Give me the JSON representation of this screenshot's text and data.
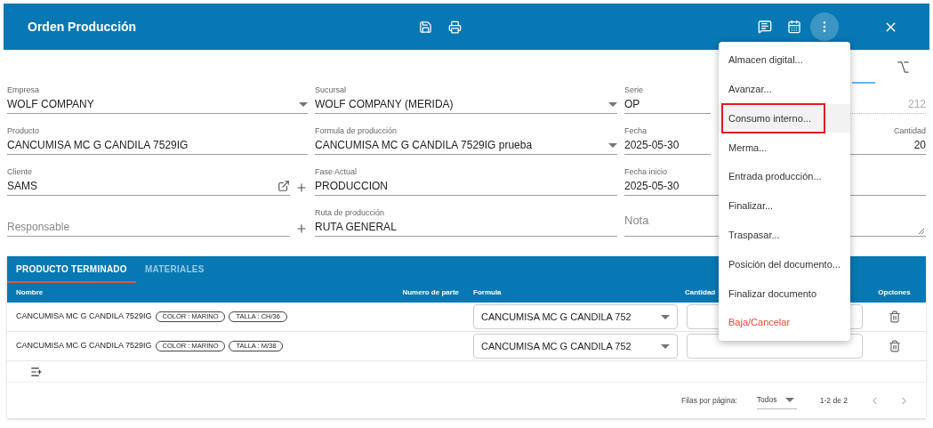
{
  "header": {
    "title": "Orden Producción"
  },
  "form": {
    "rows": [
      [
        {
          "fields": [
            {
              "label": "Empresa",
              "value": "WOLF COMPANY",
              "kind": "select"
            }
          ],
          "add_button": false
        },
        {
          "fields": [
            {
              "label": "Sucursal",
              "value": "WOLF COMPANY (MERIDA)",
              "kind": "select"
            }
          ]
        },
        {
          "fields": [
            {
              "label": "Serie",
              "value": "OP",
              "kind": "text"
            },
            {
              "value": "212",
              "kind": "text",
              "disabled": true
            }
          ]
        }
      ],
      [
        {
          "fields": [
            {
              "label": "Producto",
              "value": "CANCUMISA MC G CANDILA 7529IG",
              "kind": "text"
            }
          ],
          "add_button": false
        },
        {
          "fields": [
            {
              "label": "Formula de producción",
              "value": "CANCUMISA MC G CANDILA 7529IG prueba",
              "kind": "select"
            }
          ]
        },
        {
          "fields": [
            {
              "label": "Fecha",
              "value": "2025-05-30",
              "kind": "text"
            },
            {
              "label": "Cantidad",
              "value": "20",
              "kind": "text",
              "disabled": false
            }
          ]
        }
      ],
      [
        {
          "fields": [
            {
              "label": "Cliente",
              "value": "SAMS",
              "kind": "link"
            }
          ],
          "add_button": true
        },
        {
          "fields": [
            {
              "label": "Fase Actual",
              "value": "PRODUCCION",
              "kind": "text"
            }
          ]
        },
        {
          "fields": [
            {
              "label": "Fecha inicio",
              "value": "2025-05-30",
              "kind": "text"
            }
          ]
        }
      ],
      [
        {
          "fields": [
            {
              "placeholder": "Responsable",
              "kind": "text"
            }
          ],
          "add_button": true
        },
        {
          "fields": [
            {
              "label": "Ruta de producción",
              "value": "RUTA GENERAL",
              "kind": "text"
            }
          ]
        },
        {
          "fields": [
            {
              "placeholder": "Nota",
              "kind": "textarea"
            }
          ]
        }
      ]
    ]
  },
  "table": {
    "tabs": [
      {
        "label": "PRODUCTO TERMINADO",
        "selected": true
      },
      {
        "label": "MATERIALES",
        "selected": false
      }
    ],
    "columns": [
      "Nombre",
      "Numero de parte",
      "Formula",
      "Cantidad",
      "Opciones"
    ],
    "rows": [
      {
        "name": "CANCUMISA MC G CANDILA 7529IG",
        "tags": [
          "COLOR : MARINO",
          "TALLA : CH/36"
        ],
        "formula": "CANCUMISA MC G CANDILA 752"
      },
      {
        "name": "CANCUMISA MC G CANDILA 7529IG",
        "tags": [
          "COLOR : MARINO",
          "TALLA : M/38"
        ],
        "formula": "CANCUMISA MC G CANDILA 752"
      }
    ],
    "pagination": {
      "rows_per_page_label": "Filas por página:",
      "rows_per_page": "Todos",
      "range": "1-2 de 2"
    }
  },
  "menu": {
    "items": [
      {
        "label": "Almacen digital...",
        "kind": "normal",
        "highlighted": false
      },
      {
        "label": "Avanzar...",
        "kind": "normal",
        "highlighted": false
      },
      {
        "label": "Consumo interno...",
        "kind": "normal",
        "highlighted": true
      },
      {
        "label": "Merma...",
        "kind": "normal",
        "highlighted": false
      },
      {
        "label": "Entrada producción...",
        "kind": "normal",
        "highlighted": false
      },
      {
        "label": "Finalizar...",
        "kind": "normal",
        "highlighted": false
      },
      {
        "label": "Traspasar...",
        "kind": "normal",
        "highlighted": false
      },
      {
        "label": "Posición del documento...",
        "kind": "normal",
        "highlighted": false
      },
      {
        "label": "Finalizar documento",
        "kind": "normal",
        "highlighted": false
      },
      {
        "label": "Baja/Cancelar",
        "kind": "danger",
        "highlighted": false
      }
    ]
  }
}
